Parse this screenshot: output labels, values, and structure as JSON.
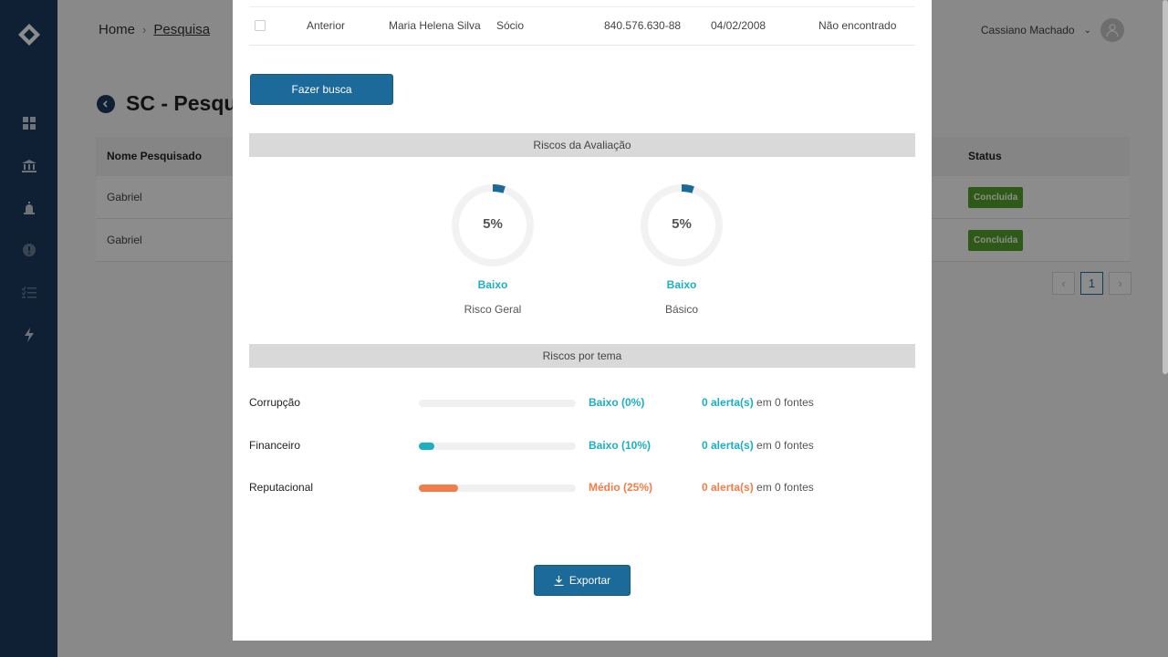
{
  "colors": {
    "sidebar": "#1d3a5f",
    "primary": "#1c6a9a",
    "low": "#1ab0c2",
    "medium": "#f47c48",
    "success": "#52a52a",
    "gauge_arc": "#1c6a9a"
  },
  "header": {
    "breadcrumb": [
      "Home",
      "Pesquisa"
    ],
    "user_name": "Cassiano Machado"
  },
  "page": {
    "title": "SC - Pesqui"
  },
  "sidebar": {
    "icons": [
      "dashboard-icon",
      "bank-icon",
      "alarm-icon",
      "alert-icon",
      "checklist-icon",
      "lightning-icon"
    ]
  },
  "background_table": {
    "headers": {
      "name": "Nome Pesquisado",
      "status": "Status"
    },
    "rows": [
      {
        "name": "Gabriel",
        "status": "Concluída"
      },
      {
        "name": "Gabriel",
        "status": "Concluída"
      }
    ],
    "pagination": {
      "current": "1"
    }
  },
  "modal": {
    "person_row": {
      "period": "Anterior",
      "name": "Maria Helena Silva",
      "role": "Sócio",
      "cpf": "840.576.630-88",
      "date": "04/02/2008",
      "result": "Não encontrado"
    },
    "search_button": "Fazer busca",
    "risks_header": "Riscos da Avaliação",
    "gauges": [
      {
        "value": "5%",
        "fraction": 0.05,
        "level": "Baixo",
        "name": "Risco Geral"
      },
      {
        "value": "5%",
        "fraction": 0.05,
        "level": "Baixo",
        "name": "Básico"
      }
    ],
    "themes_header": "Riscos por tema",
    "themes": [
      {
        "name": "Corrupção",
        "level": "Baixo (0%)",
        "percent": 0,
        "tone": "low",
        "alerts": "0 alerta(s)",
        "sources": "em 0 fontes"
      },
      {
        "name": "Financeiro",
        "level": "Baixo (10%)",
        "percent": 10,
        "tone": "low",
        "alerts": "0 alerta(s)",
        "sources": "em 0 fontes"
      },
      {
        "name": "Reputacional",
        "level": "Médio (25%)",
        "percent": 25,
        "tone": "medium",
        "alerts": "0 alerta(s)",
        "sources": "em 0 fontes"
      }
    ],
    "export_button": "Exportar"
  }
}
